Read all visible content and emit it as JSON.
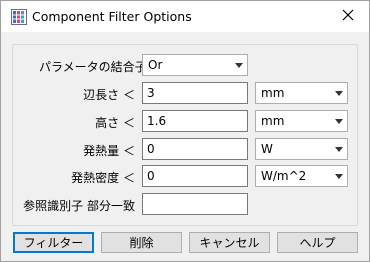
{
  "window": {
    "title": "Component Filter Options",
    "icon": "component-filter-app-icon",
    "close_icon": "close-icon"
  },
  "form": {
    "combine": {
      "label": "パラメータの結合子",
      "value": "Or"
    },
    "side_length": {
      "label": "辺長さ ＜",
      "value": "3",
      "unit": "mm"
    },
    "height": {
      "label": "高さ ＜",
      "value": "1.6",
      "unit": "mm"
    },
    "heat": {
      "label": "発熱量 ＜",
      "value": "0",
      "unit": "W"
    },
    "heat_density": {
      "label": "発熱密度 ＜",
      "value": "0",
      "unit": "W/m^2"
    },
    "reference": {
      "label": "参照識別子 部分一致",
      "value": ""
    }
  },
  "buttons": {
    "filter": "フィルター",
    "delete": "削除",
    "cancel": "キャンセル",
    "help": "ヘルプ"
  },
  "colors": {
    "accent": "#0078d7",
    "window_bg": "#f0f0f0",
    "button_bg": "#e1e1e1"
  }
}
